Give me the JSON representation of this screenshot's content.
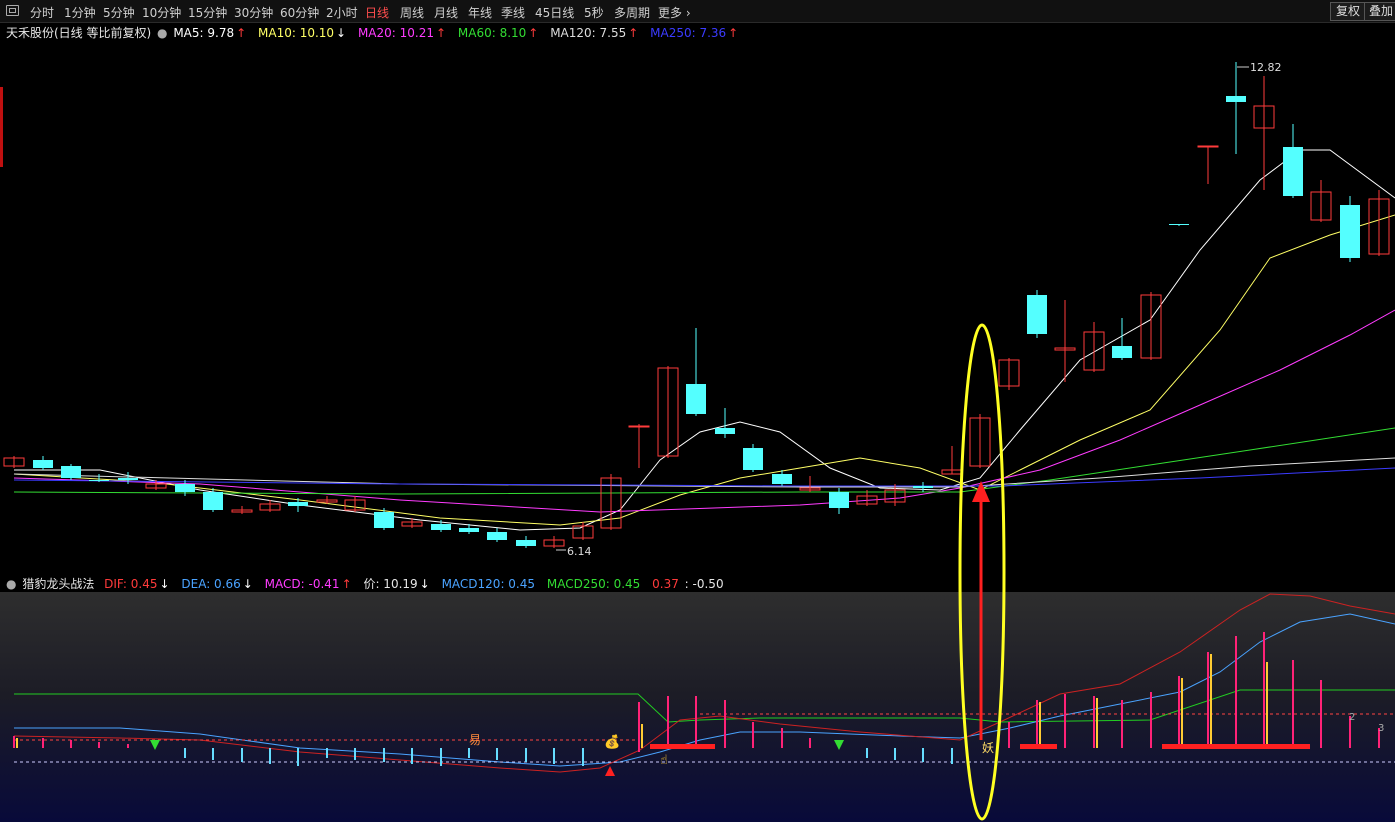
{
  "toolbar": {
    "tabs": [
      "分时",
      "1分钟",
      "5分钟",
      "10分钟",
      "15分钟",
      "30分钟",
      "60分钟",
      "2小时",
      "日线",
      "周线",
      "月线",
      "年线",
      "季线",
      "45日线",
      "5秒",
      "多周期",
      "更多"
    ],
    "active_tab": "日线",
    "restore_label": "复权",
    "overlay_label": "叠加"
  },
  "legend": {
    "stock_title": "天禾股份(日线 等比前复权)",
    "ma5": "MA5: 9.78",
    "ma5_arrow": "↑",
    "ma10": "MA10: 10.10",
    "ma10_arrow": "↓",
    "ma20": "MA20: 10.21",
    "ma20_arrow": "↑",
    "ma60": "MA60: 8.10",
    "ma60_arrow": "↑",
    "ma120": "MA120: 7.55",
    "ma120_arrow": "↑",
    "ma250": "MA250: 7.36",
    "ma250_arrow": "↑"
  },
  "price_chart": {
    "high_label": "12.82",
    "low_label": "6.14"
  },
  "indicator": {
    "name": "猎豹龙头战法",
    "dif": "DIF: 0.45",
    "dif_arrow": "↓",
    "dea": "DEA: 0.66",
    "dea_arrow": "↓",
    "macd": "MACD: -0.41",
    "macd_arrow": "↑",
    "price": "价: 10.19",
    "price_arrow": "↓",
    "macd120": "MACD120: 0.45",
    "macd250": "MACD250: 0.45",
    "v1": "0.37",
    "v2": ": -0.50",
    "marker_yi": "易",
    "marker_yao": "妖",
    "marker_2": "2",
    "marker_3": "3"
  },
  "colors": {
    "up": "#ff3b3b",
    "down": "#54ffff",
    "ma5": "#ffffff",
    "ma10": "#ffff66",
    "ma20": "#ff3cff",
    "ma60": "#33dd33",
    "ma120": "#dddddd",
    "ma250": "#3b3bff",
    "annotation": "#ffff22"
  },
  "chart_data": {
    "type": "candlestick",
    "ma_series": [
      "MA5",
      "MA10",
      "MA20",
      "MA60",
      "MA120",
      "MA250"
    ],
    "high": 12.82,
    "low": 6.14
  }
}
